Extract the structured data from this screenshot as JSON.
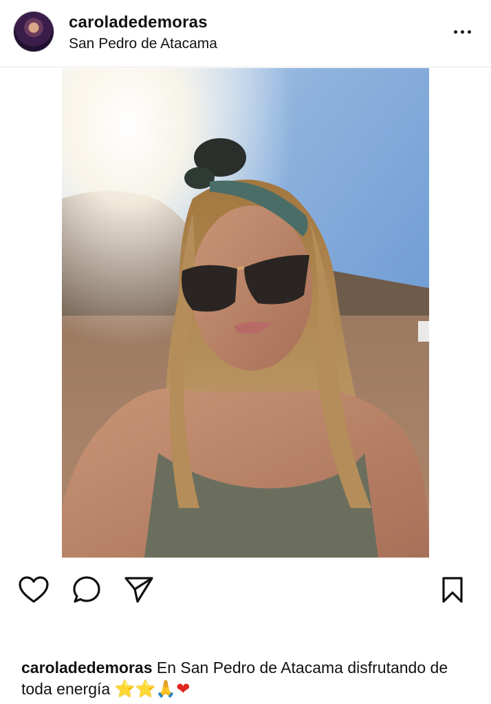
{
  "post": {
    "username": "caroladedemoras",
    "location": "San Pedro de Atacama"
  },
  "header": {
    "username": "caroladedemoras",
    "location": "San Pedro de Atacama"
  },
  "caption": {
    "username": "caroladedemoras",
    "text": "En San Pedro de Atacama disfrutando de toda energía",
    "emojis": [
      "⭐",
      "⭐",
      "🙏",
      "❤"
    ]
  },
  "icons": {
    "more": "more-options-icon",
    "like": "heart-icon",
    "comment": "comment-icon",
    "share": "send-icon",
    "save": "bookmark-icon"
  },
  "colors": {
    "text": "#111111",
    "divider": "#e6e6e6",
    "sky": "#5d8fcf"
  }
}
